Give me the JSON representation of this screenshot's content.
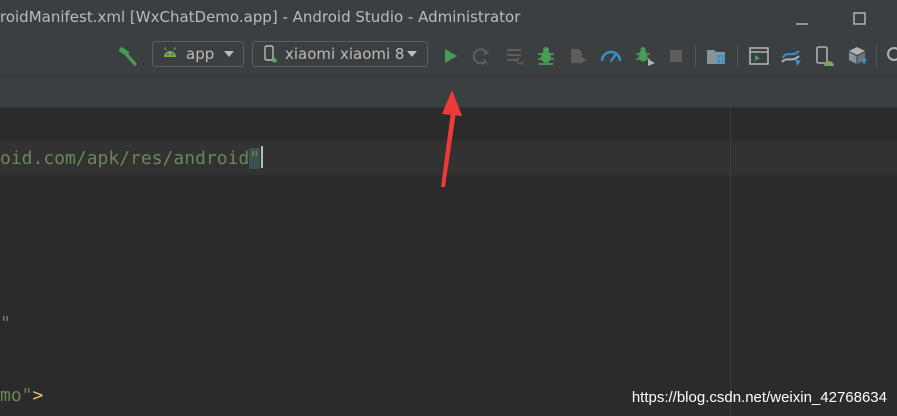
{
  "window": {
    "title": "roidManifest.xml [WxChatDemo.app] - Android Studio - Administrator"
  },
  "toolbar": {
    "config_selector": {
      "label": "app",
      "icon": "android-icon"
    },
    "device_selector": {
      "label": "xiaomi xiaomi 8",
      "icon": "phone-icon"
    },
    "icons": [
      "hammer-build-icon",
      "run-icon",
      "apply-changes-icon",
      "apply-code-changes-icon",
      "debug-icon",
      "attach-debugger-icon",
      "profile-icon",
      "debug-attach-icon",
      "stop-icon",
      "project-structure-icon",
      "terminal-icon",
      "sync-icon",
      "avd-manager-icon",
      "sdk-manager-icon",
      "search-icon"
    ],
    "colors": {
      "run": "#499c54",
      "debug": "#499c54",
      "profile": "#3592c4"
    }
  },
  "editor": {
    "lines": [
      {
        "segments": [
          {
            "text": "oid.com/apk/res/android",
            "kind": "string"
          },
          {
            "text": "\"",
            "kind": "string-highlight"
          }
        ]
      },
      {
        "segments": [
          {
            "text": "\"",
            "kind": "string"
          }
        ]
      },
      {
        "segments": [
          {
            "text": "mo\"",
            "kind": "string"
          },
          {
            "text": ">",
            "kind": "tag"
          }
        ]
      }
    ]
  },
  "annotation": {
    "color": "#f03a3a",
    "points_to": "run-icon"
  },
  "watermark": "https://blog.csdn.net/weixin_42768634"
}
